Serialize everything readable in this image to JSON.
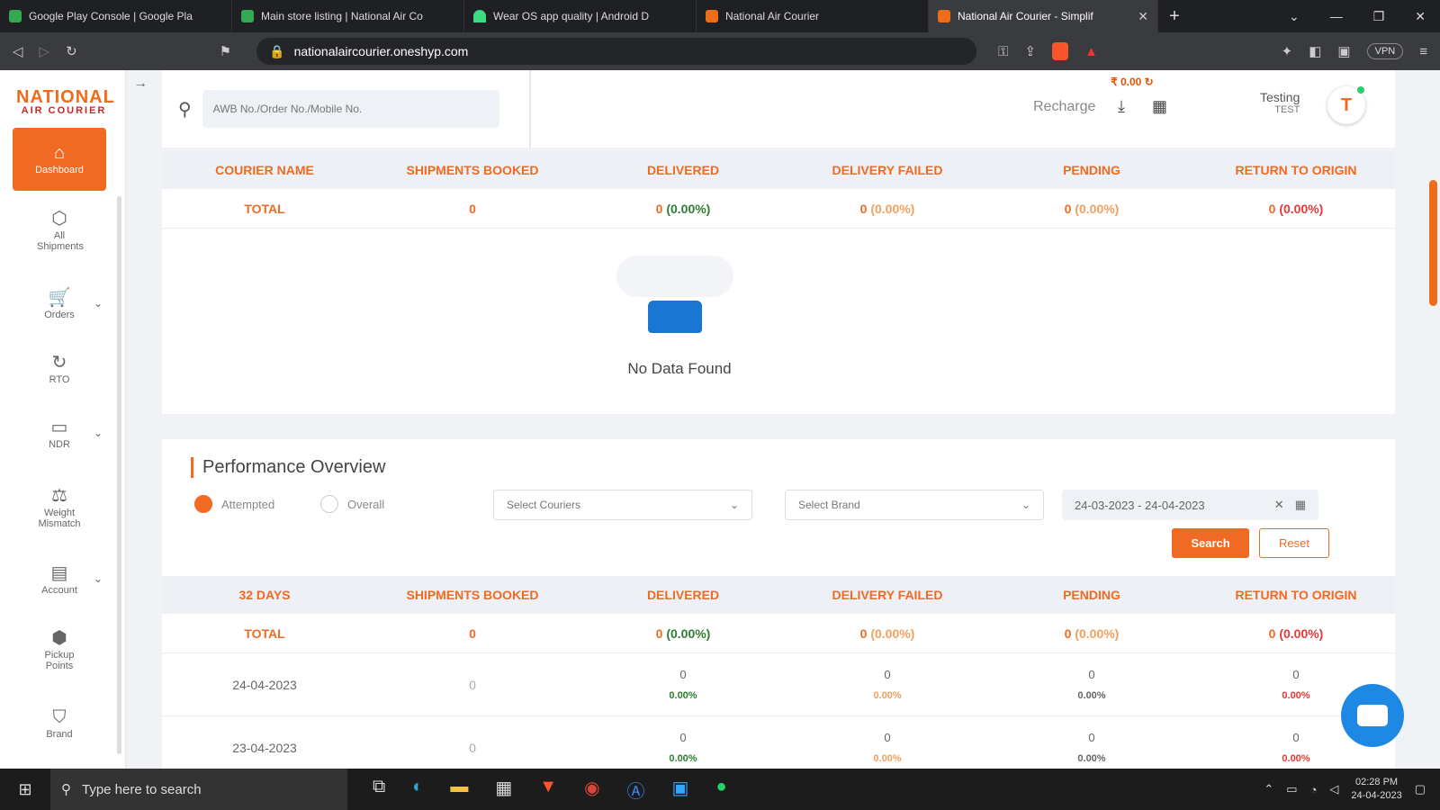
{
  "browser": {
    "tabs": [
      {
        "title": "Google Play Console | Google Pla",
        "color": "#34a853"
      },
      {
        "title": "Main store listing | National Air Co",
        "color": "#34a853"
      },
      {
        "title": "Wear OS app quality  |  Android D",
        "color": "#3ddc84"
      },
      {
        "title": "National Air Courier",
        "color": "#ef6c1a"
      },
      {
        "title": "National Air Courier - Simplif",
        "color": "#ef6c1a"
      }
    ],
    "url": "nationalaircourier.oneshyp.com",
    "vpn_label": "VPN"
  },
  "brand": {
    "line1": "NATIONAL",
    "line2": "AIR COURIER"
  },
  "sidebar": {
    "items": [
      {
        "label": "Dashboard",
        "icon": "home-icon",
        "glyph": "⌂"
      },
      {
        "label": "All Shipments",
        "icon": "box-icon",
        "glyph": "⬡"
      },
      {
        "label": "Orders",
        "icon": "cart-icon",
        "glyph": "🛒"
      },
      {
        "label": "RTO",
        "icon": "refresh-icon",
        "glyph": "↻"
      },
      {
        "label": "NDR",
        "icon": "message-icon",
        "glyph": "▭"
      },
      {
        "label": "Weight Mismatch",
        "icon": "scale-icon",
        "glyph": "⚖"
      },
      {
        "label": "Account",
        "icon": "wallet-icon",
        "glyph": "▤"
      },
      {
        "label": "Pickup Points",
        "icon": "package-icon",
        "glyph": "⬢"
      },
      {
        "label": "Brand",
        "icon": "tag-icon",
        "glyph": "⌂"
      }
    ]
  },
  "header": {
    "search_placeholder": "AWB No./Order No./Mobile No.",
    "balance": "₹ 0.00",
    "recharge_label": "Recharge",
    "user_name": "Testing",
    "user_sub": "TEST",
    "avatar_letter": "T"
  },
  "courier_table": {
    "headers": [
      "COURIER NAME",
      "SHIPMENTS BOOKED",
      "DELIVERED",
      "DELIVERY FAILED",
      "PENDING",
      "RETURN TO ORIGIN"
    ],
    "total_row": {
      "label": "TOTAL",
      "booked": "0",
      "delivered": "0",
      "delivered_pct": "(0.00%)",
      "failed": "0",
      "failed_pct": "(0.00%)",
      "pending": "0",
      "pending_pct": "(0.00%)",
      "rto": "0",
      "rto_pct": "(0.00%)"
    },
    "empty_message": "No Data Found"
  },
  "performance": {
    "title": "Performance Overview",
    "radio_attempted": "Attempted",
    "radio_overall": "Overall",
    "select_couriers": "Select Couriers",
    "select_brand": "Select Brand",
    "date_range": "24-03-2023 - 24-04-2023",
    "search_label": "Search",
    "reset_label": "Reset",
    "headers": [
      "32 DAYS",
      "SHIPMENTS BOOKED",
      "DELIVERED",
      "DELIVERY FAILED",
      "PENDING",
      "RETURN TO ORIGIN"
    ],
    "total_row": {
      "label": "TOTAL",
      "booked": "0",
      "delivered": "0",
      "delivered_pct": "(0.00%)",
      "failed": "0",
      "failed_pct": "(0.00%)",
      "pending": "0",
      "pending_pct": "(0.00%)",
      "rto": "0",
      "rto_pct": "(0.00%)"
    },
    "rows": [
      {
        "date": "24-04-2023",
        "booked": "0",
        "delivered": "0",
        "delivered_pct": "0.00%",
        "failed": "0",
        "failed_pct": "0.00%",
        "pending": "0",
        "pending_pct": "0.00%",
        "rto": "0",
        "rto_pct": "0.00%"
      },
      {
        "date": "23-04-2023",
        "booked": "0",
        "delivered": "0",
        "delivered_pct": "0.00%",
        "failed": "0",
        "failed_pct": "0.00%",
        "pending": "0",
        "pending_pct": "0.00%",
        "rto": "0",
        "rto_pct": "0.00%"
      }
    ]
  },
  "taskbar": {
    "search_placeholder": "Type here to search",
    "time": "02:28 PM",
    "date": "24-04-2023"
  },
  "colors": {
    "accent": "#f06a23",
    "green": "#2e7d32",
    "red": "#e53935",
    "chat": "#1e88e5"
  }
}
